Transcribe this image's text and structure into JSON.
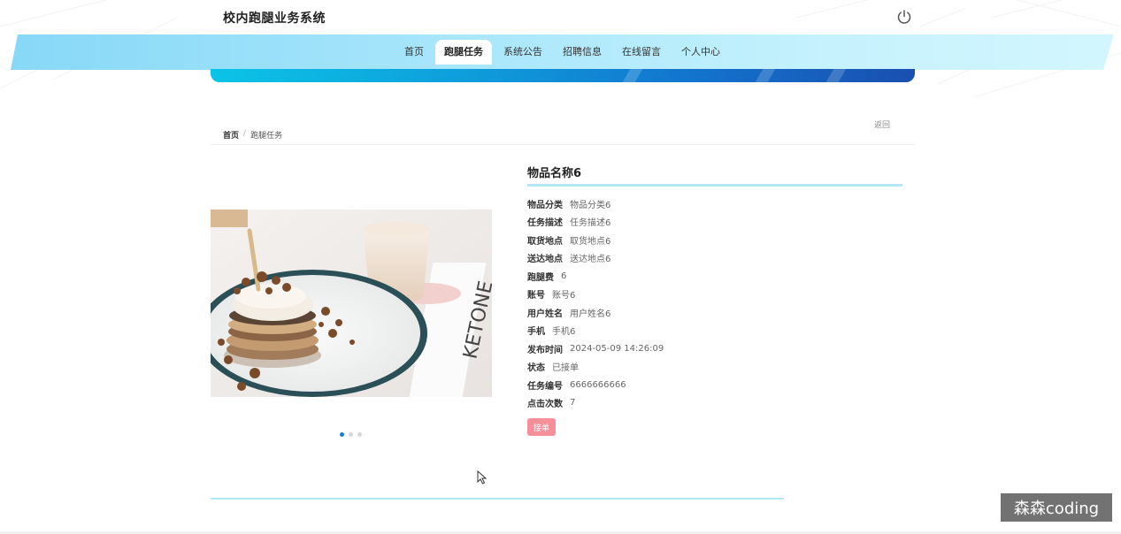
{
  "app": {
    "title": "校内跑腿业务系统"
  },
  "header": {
    "power_icon": "power-icon"
  },
  "nav": {
    "items": [
      {
        "label": "首页",
        "active": false
      },
      {
        "label": "跑腿任务",
        "active": true
      },
      {
        "label": "系统公告",
        "active": false
      },
      {
        "label": "招聘信息",
        "active": false
      },
      {
        "label": "在线留言",
        "active": false
      },
      {
        "label": "个人中心",
        "active": false
      }
    ]
  },
  "breadcrumb": {
    "home": "首页",
    "separator": "/",
    "current": "跑腿任务"
  },
  "back_label": "返回",
  "item": {
    "name": "物品名称6",
    "fields": [
      {
        "label": "物品分类",
        "value": "物品分类6"
      },
      {
        "label": "任务描述",
        "value": "任务描述6"
      },
      {
        "label": "取货地点",
        "value": "取货地点6"
      },
      {
        "label": "送达地点",
        "value": "送达地点6"
      },
      {
        "label": "跑腿费",
        "value": "6"
      },
      {
        "label": "账号",
        "value": "账号6"
      },
      {
        "label": "用户姓名",
        "value": "用户姓名6"
      },
      {
        "label": "手机",
        "value": "手机6"
      },
      {
        "label": "发布时间",
        "value": "2024-05-09 14:26:09"
      },
      {
        "label": "状态",
        "value": "已接单"
      },
      {
        "label": "任务编号",
        "value": "6666666666"
      },
      {
        "label": "点击次数",
        "value": "7"
      }
    ],
    "action_label": "接单"
  },
  "carousel": {
    "count": 3,
    "active_index": 0
  },
  "watermark": "森森coding",
  "colors": {
    "nav_band": "#a8e6fb",
    "banner": "#0e9fdc",
    "accent_line": "#b3e7f5",
    "button": "#f5909a",
    "dot_active": "#1a7ddc"
  }
}
